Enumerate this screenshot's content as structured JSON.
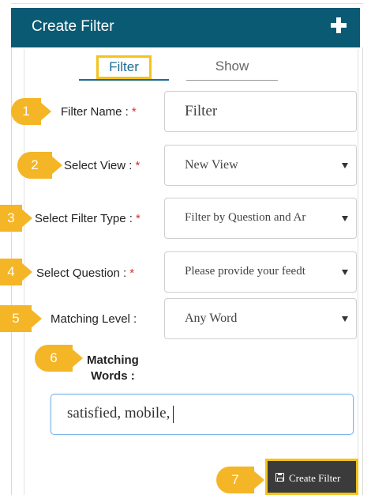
{
  "header": {
    "title": "Create Filter",
    "add_icon": "plus-icon"
  },
  "tabs": [
    {
      "label": "Filter",
      "active": true
    },
    {
      "label": "Show",
      "active": false
    }
  ],
  "form": {
    "filter_name": {
      "badge": "1",
      "label": "Filter Name :",
      "required": "*",
      "value": "Filter"
    },
    "select_view": {
      "badge": "2",
      "label": "Select View :",
      "required": "*",
      "value": "New View"
    },
    "filter_type": {
      "badge": "3",
      "label": "Select Filter Type :",
      "required": "*",
      "value": "Filter by Question and Ar"
    },
    "question": {
      "badge": "4",
      "label": "Select Question :",
      "required": "*",
      "value": "Please provide your feedt"
    },
    "matching_level": {
      "badge": "5",
      "label": "Matching Level :",
      "value": "Any Word"
    },
    "matching_words": {
      "badge": "6",
      "label_line1": "Matching",
      "label_line2": "Words :",
      "value": "satisfied, mobile,"
    }
  },
  "submit": {
    "badge": "7",
    "label": "Create Filter",
    "icon": "save-icon"
  },
  "colors": {
    "header_bg": "#0b5a73",
    "badge": "#f4b526",
    "highlight": "#f4c31c",
    "accent": "#1b6c94"
  }
}
